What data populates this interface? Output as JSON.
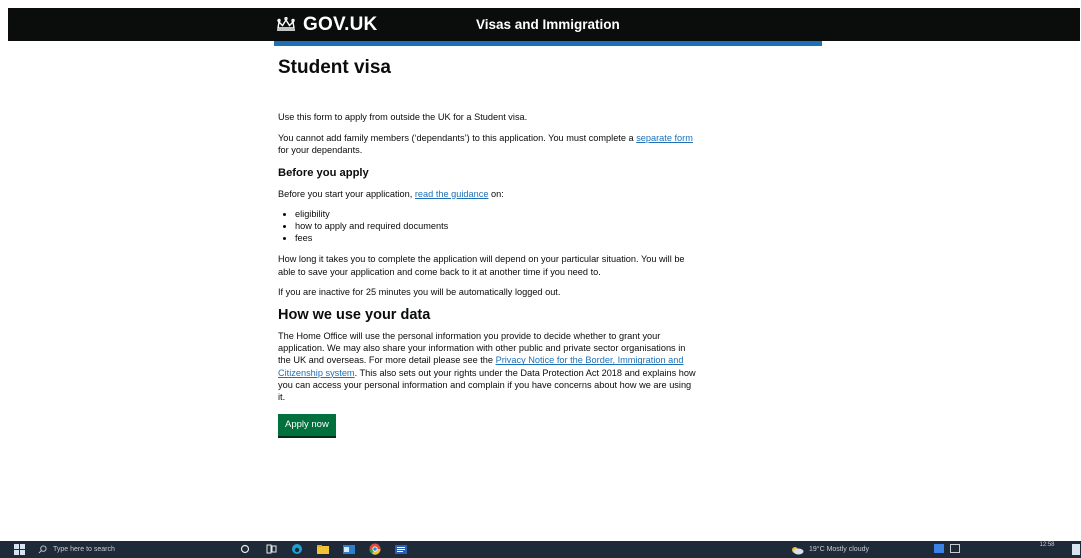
{
  "header": {
    "logo_text": "GOV.UK",
    "service_name": "Visas and Immigration"
  },
  "page": {
    "title": "Student visa",
    "intro": "Use this form to apply from outside the UK for a Student visa.",
    "dependants_text_1": "You cannot add family members (‘dependants’) to this application. You must complete a ",
    "dependants_link": "separate form",
    "dependants_text_2": " for your dependants.",
    "before_heading": "Before you apply",
    "before_text_1": "Before you start your application, ",
    "before_link": "read the guidance",
    "before_text_2": " on:",
    "guidance_items": [
      "eligibility",
      "how to apply and required documents",
      "fees"
    ],
    "duration_text": "How long it takes you to complete the application will depend on your particular situation. You will be able to save your application and come back to it at another time if you need to.",
    "inactive_text": "If you are inactive for 25 minutes you will be automatically logged out.",
    "data_heading": "How we use your data",
    "data_text_1": "The Home Office will use the personal information you provide to decide whether to grant your application. We may also share your information with other public and private sector organisations in the UK and overseas. For more detail please see the ",
    "data_link": "Privacy Notice for the Border, Immigration and Citizenship system",
    "data_text_2": ". This also sets out your rights under the Data Protection Act 2018 and explains how you can access your personal information and complain if you have concerns about how we are using it.",
    "apply_button": "Apply now"
  },
  "taskbar": {
    "search_placeholder": "Type here to search",
    "weather": "19°C  Mostly cloudy",
    "time": "12:58"
  },
  "colors": {
    "header_bg": "#0b0c0c",
    "accent_blue": "#1d70b8",
    "button_green": "#00703c",
    "taskbar_bg": "#1f2a38"
  }
}
